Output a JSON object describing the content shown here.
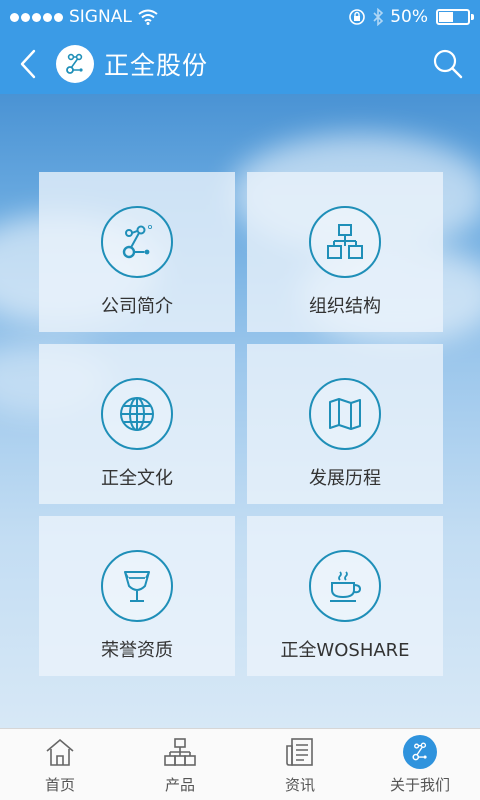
{
  "status_bar": {
    "carrier": "SIGNAL",
    "signal_bars": 5,
    "battery_text": "50%",
    "battery_level": 0.5
  },
  "header": {
    "title": "正全股份"
  },
  "tiles": [
    {
      "label": "公司简介",
      "icon": "company-logo-icon"
    },
    {
      "label": "组织结构",
      "icon": "org-chart-icon"
    },
    {
      "label": "正全文化",
      "icon": "globe-icon"
    },
    {
      "label": "发展历程",
      "icon": "map-icon"
    },
    {
      "label": "荣誉资质",
      "icon": "trophy-icon"
    },
    {
      "label": "正全WOSHARE",
      "icon": "coffee-cup-icon"
    }
  ],
  "tabbar": {
    "items": [
      {
        "label": "首页",
        "icon": "home-icon",
        "active": false
      },
      {
        "label": "产品",
        "icon": "product-icon",
        "active": false
      },
      {
        "label": "资讯",
        "icon": "news-icon",
        "active": false
      },
      {
        "label": "关于我们",
        "icon": "about-icon",
        "active": true
      }
    ]
  },
  "colors": {
    "accent": "#3b9be6",
    "icon_stroke": "#1f8fb8",
    "tab_active": "#2f93dd"
  }
}
